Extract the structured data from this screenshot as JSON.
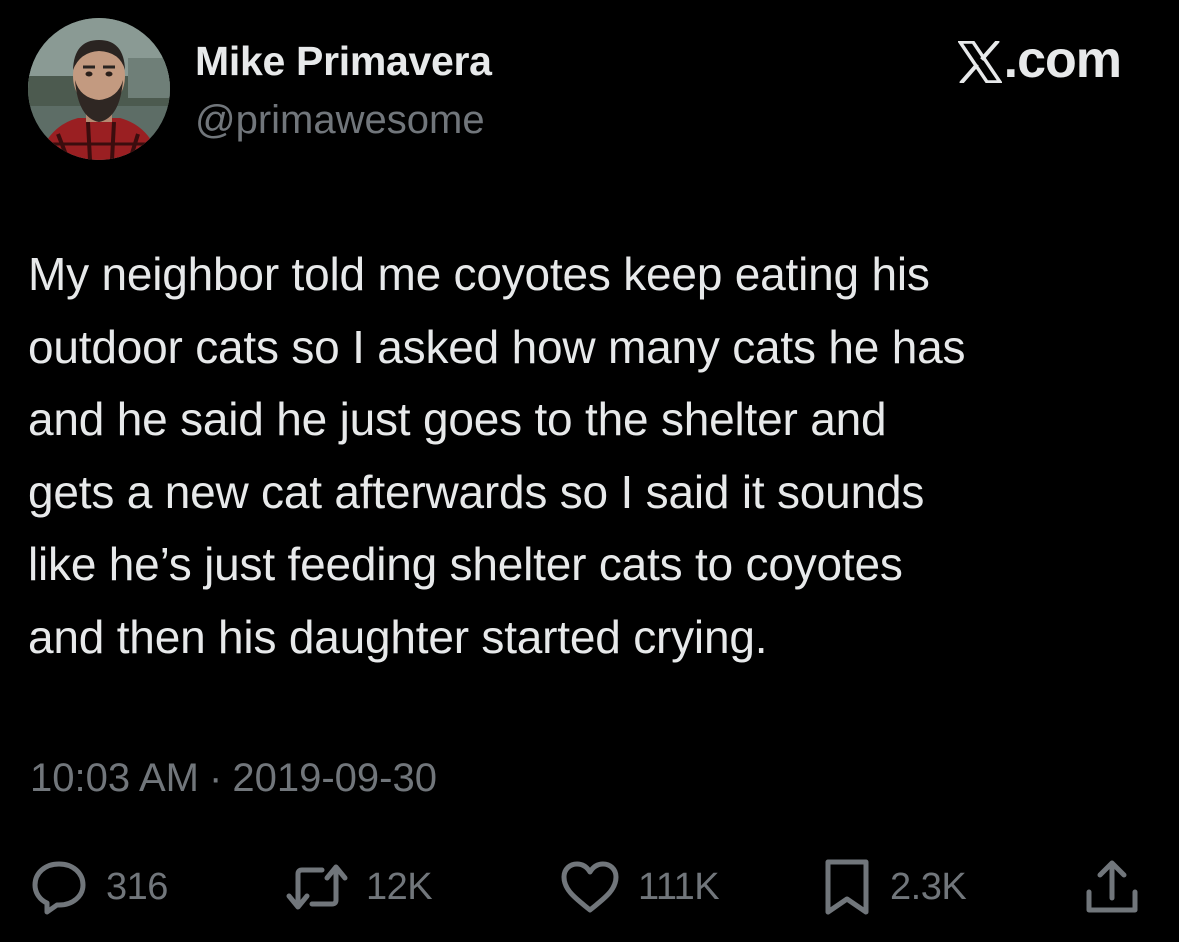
{
  "author": {
    "name": "Mike Primavera",
    "handle": "@primawesome"
  },
  "brand": {
    "label": ".com",
    "icon": "x-logo-icon"
  },
  "tweet": {
    "text": "My neighbor told me coyotes keep eating his\noutdoor cats so I asked how many cats he has\nand he said he just goes to the shelter and\ngets a new cat afterwards so I said it sounds\nlike he’s just feeding shelter cats to coyotes\nand then his daughter started crying."
  },
  "meta": {
    "time": "10:03 AM",
    "separator": "·",
    "date": "2019-09-30"
  },
  "actions": {
    "replies": "316",
    "retweets": "12K",
    "likes": "111K",
    "bookmarks": "2.3K"
  },
  "colors": {
    "background": "#000000",
    "primary_text": "#e7e9ea",
    "secondary_text": "#71767b"
  }
}
